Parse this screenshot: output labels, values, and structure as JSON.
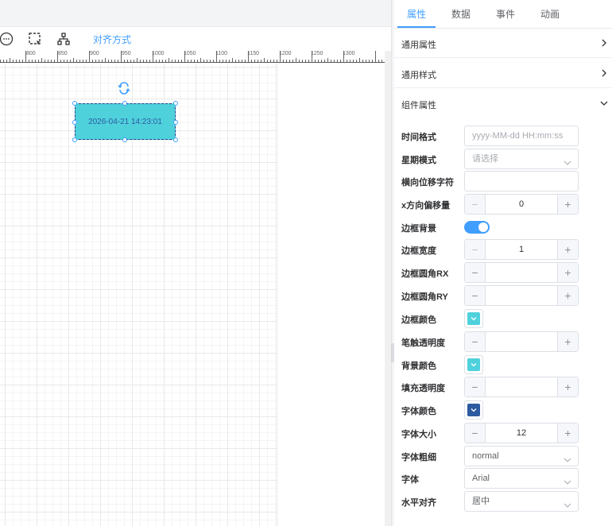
{
  "toolbar": {
    "align_label": "对齐方式",
    "icons": [
      "circle-ellipsis-icon",
      "select-region-icon",
      "hierarchy-icon"
    ]
  },
  "ruler": {
    "labels": [
      "800",
      "850",
      "900",
      "950",
      "1000",
      "1050",
      "1100",
      "1150",
      "1200",
      "1250",
      "1300"
    ]
  },
  "widget": {
    "text": "2026-04-21 14:23:01",
    "background": "#4fd1dc",
    "text_color": "#2c5aa0"
  },
  "panel": {
    "tabs": [
      "属性",
      "数据",
      "事件",
      "动画"
    ],
    "active_tab": "属性",
    "sections": {
      "general_props": "通用属性",
      "general_style": "通用样式",
      "component_props": "组件属性"
    },
    "fields": {
      "time_format": {
        "label": "时间格式",
        "placeholder": "yyyy-MM-dd HH:mm:ss"
      },
      "week_mode": {
        "label": "星期模式",
        "placeholder": "请选择"
      },
      "h_offset_char": {
        "label": "横向位移字符",
        "value": ""
      },
      "x_offset": {
        "label": "x方向偏移量",
        "value": "0"
      },
      "border_bg": {
        "label": "边框背景",
        "checked": true
      },
      "border_width": {
        "label": "边框宽度",
        "value": "1"
      },
      "border_rx": {
        "label": "边框圆角RX",
        "value": ""
      },
      "border_ry": {
        "label": "边框圆角RY",
        "value": ""
      },
      "border_color": {
        "label": "边框颜色",
        "color": "#4fd1dc"
      },
      "stroke_opacity": {
        "label": "笔触透明度",
        "value": ""
      },
      "bg_color": {
        "label": "背景颜色",
        "color": "#4fd1dc"
      },
      "fill_opacity": {
        "label": "填充透明度",
        "value": ""
      },
      "font_color": {
        "label": "字体颜色",
        "color": "#2c5aa0"
      },
      "font_size": {
        "label": "字体大小",
        "value": "12"
      },
      "font_weight": {
        "label": "字体粗细",
        "value": "normal"
      },
      "font_family": {
        "label": "字体",
        "value": "Arial"
      },
      "h_align": {
        "label": "水平对齐",
        "value": "居中"
      }
    }
  },
  "colors": {
    "accent": "#409eff",
    "widget_fill": "#4fd1dc"
  }
}
